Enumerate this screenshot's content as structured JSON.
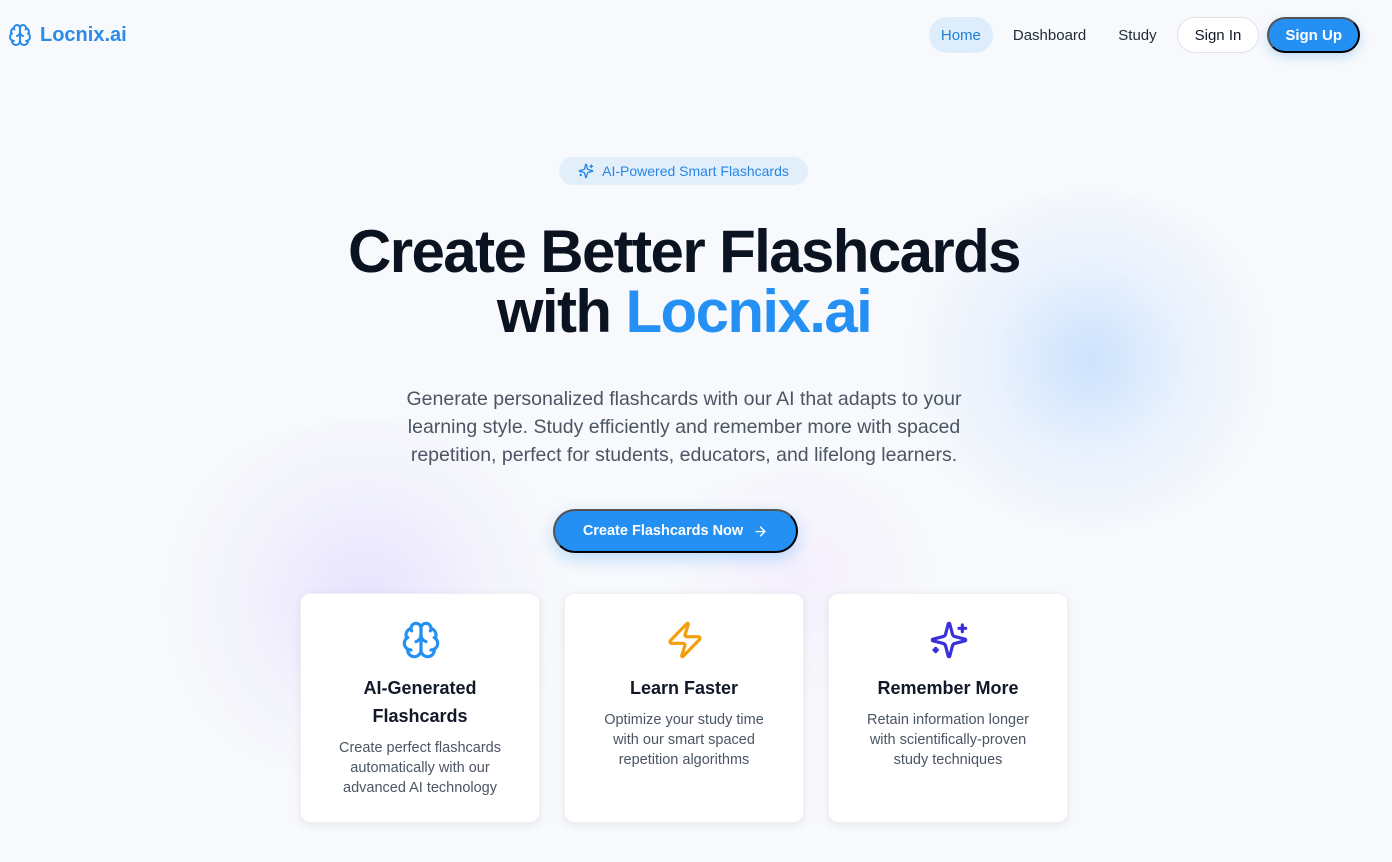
{
  "brand": {
    "name": "Locnix.ai",
    "icon": "brain-icon",
    "color": "#2b8be6"
  },
  "nav": {
    "links": [
      {
        "label": "Home",
        "active": true
      },
      {
        "label": "Dashboard",
        "active": false
      },
      {
        "label": "Study",
        "active": false
      }
    ],
    "sign_in": "Sign In",
    "sign_up": "Sign Up"
  },
  "hero": {
    "badge": {
      "icon": "sparkles-icon",
      "label": "AI-Powered Smart Flashcards"
    },
    "title_line1": "Create Better Flashcards",
    "title_prefix": "with ",
    "title_accent": "Locnix.ai",
    "subtitle": "Generate personalized flashcards with our AI that adapts to your learning style. Study efficiently and remember more with spaced repetition, perfect for students, educators, and lifelong learners.",
    "cta": {
      "label": "Create Flashcards Now",
      "icon": "arrow-right-icon"
    }
  },
  "features": [
    {
      "icon": "brain-icon",
      "icon_color": "#2490f4",
      "title": "AI-Generated Flashcards",
      "description": "Create perfect flashcards automatically with our advanced AI technology"
    },
    {
      "icon": "lightning-icon",
      "icon_color": "#f59e0b",
      "title": "Learn Faster",
      "description": "Optimize your study time with our smart spaced repetition algorithms"
    },
    {
      "icon": "sparkles-icon",
      "icon_color": "#3b2fd9",
      "title": "Remember More",
      "description": "Retain information longer with scientifically-proven study techniques"
    }
  ],
  "colors": {
    "primary": "#2490f4",
    "background": "#f7f9fc",
    "text": "#0b1220",
    "muted": "#4b5563"
  }
}
